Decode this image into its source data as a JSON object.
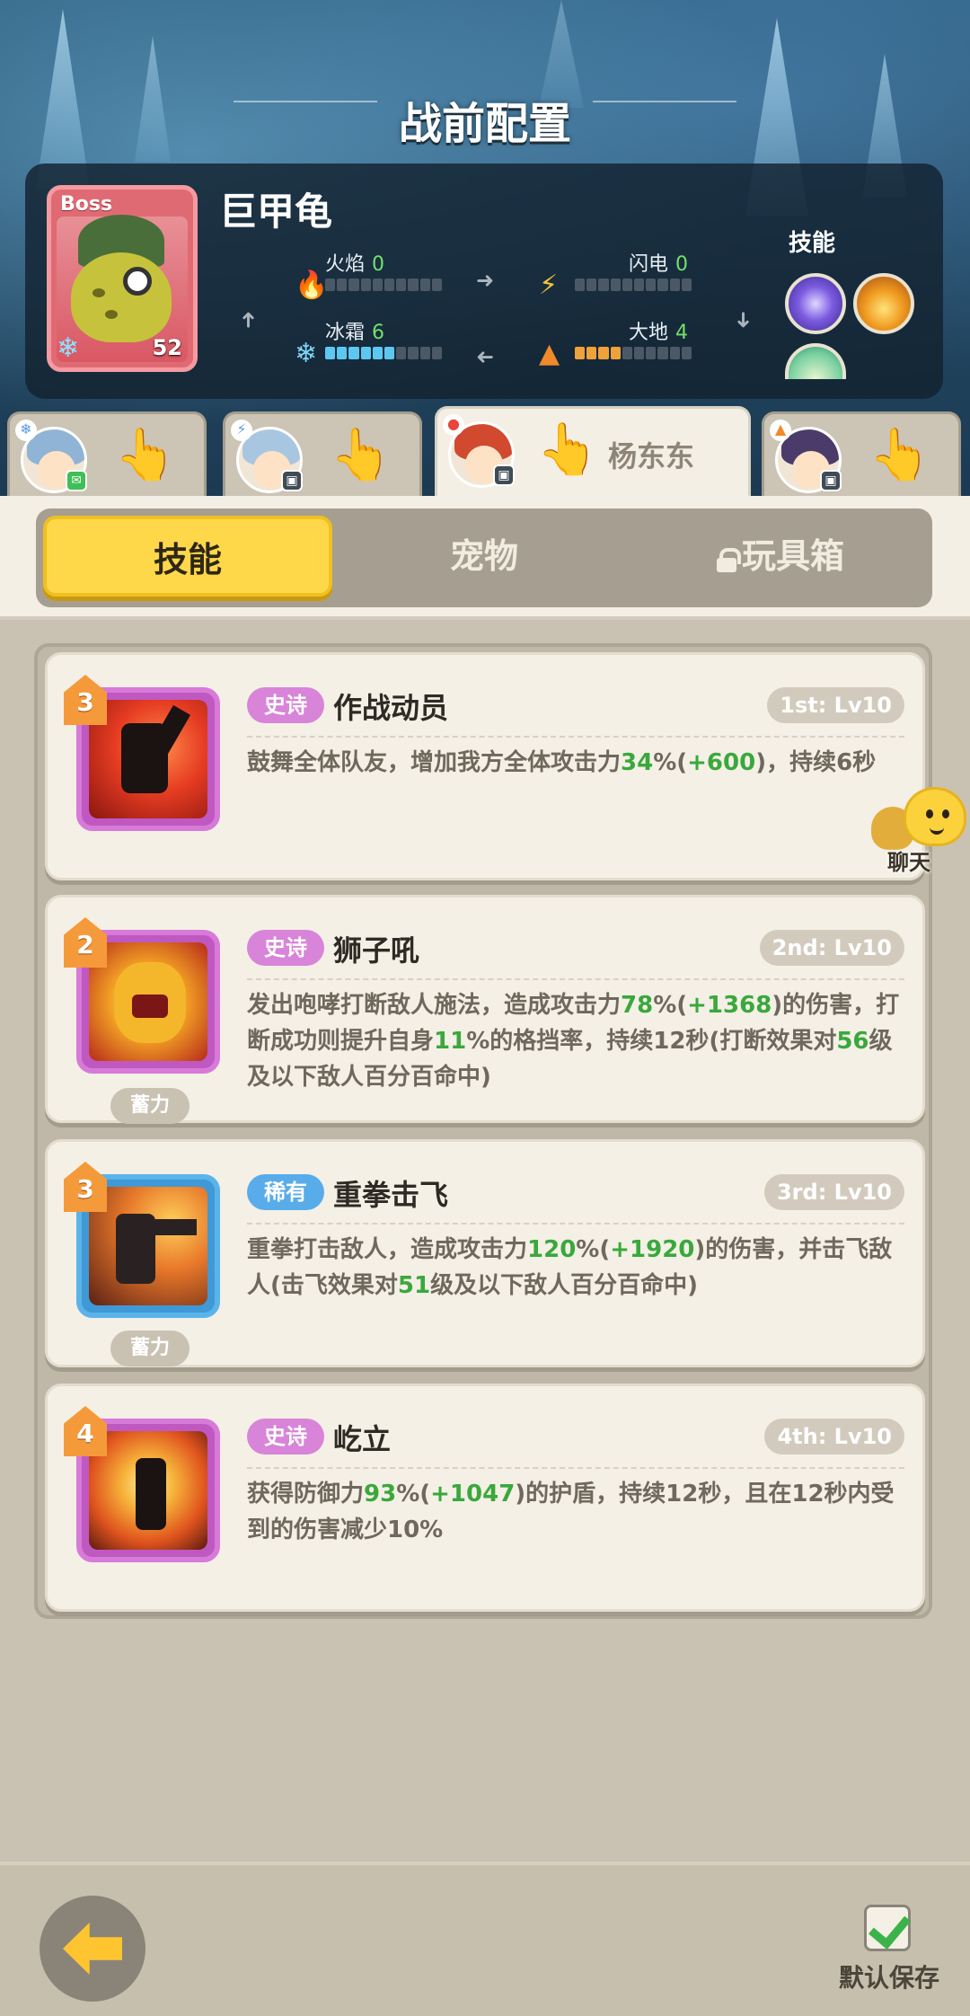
{
  "header": {
    "title": "战前配置"
  },
  "boss": {
    "tag": "Boss",
    "name": "巨甲龟",
    "level": "52",
    "stats": [
      {
        "label": "火焰",
        "value": "0",
        "level": 0,
        "icon": "fire-icon"
      },
      {
        "label": "闪电",
        "value": "0",
        "level": 0,
        "icon": "lightning-icon"
      },
      {
        "label": "冰霜",
        "value": "6",
        "level": 6,
        "icon": "frost-icon"
      },
      {
        "label": "大地",
        "value": "4",
        "level": 4,
        "icon": "earth-icon"
      }
    ],
    "skills_label": "技能"
  },
  "hero_tabs": [
    {
      "name": ""
    },
    {
      "name": ""
    },
    {
      "name": "杨东东",
      "active": true
    },
    {
      "name": ""
    }
  ],
  "segments": {
    "skills": "技能",
    "pets": "宠物",
    "toybox": "玩具箱"
  },
  "skills": [
    {
      "tier": "3",
      "rarity": "史诗",
      "name": "作战动员",
      "slot": "1st: Lv10",
      "charge": "",
      "desc": [
        {
          "t": "鼓舞全体队友，增加我方全体攻击力"
        },
        {
          "t": "34",
          "g": true
        },
        {
          "t": "%("
        },
        {
          "t": "+600",
          "g": true
        },
        {
          "t": ")，持续6秒"
        }
      ]
    },
    {
      "tier": "2",
      "rarity": "史诗",
      "name": "狮子吼",
      "slot": "2nd: Lv10",
      "charge": "蓄力",
      "desc": [
        {
          "t": "发出咆哮打断敌人施法，造成攻击力"
        },
        {
          "t": "78",
          "g": true
        },
        {
          "t": "%("
        },
        {
          "t": "+1368",
          "g": true
        },
        {
          "t": ")的伤害，打断成功则提升自身"
        },
        {
          "t": "11",
          "g": true
        },
        {
          "t": "%的格挡率，持续12秒(打断效果对"
        },
        {
          "t": "56",
          "g": true
        },
        {
          "t": "级及以下敌人百分百命中)"
        }
      ]
    },
    {
      "tier": "3",
      "rarity": "稀有",
      "name": "重拳击飞",
      "slot": "3rd: Lv10",
      "charge": "蓄力",
      "desc": [
        {
          "t": "重拳打击敌人，造成攻击力"
        },
        {
          "t": "120",
          "g": true
        },
        {
          "t": "%("
        },
        {
          "t": "+1920",
          "g": true
        },
        {
          "t": ")的伤害，并击飞敌人(击飞效果对"
        },
        {
          "t": "51",
          "g": true
        },
        {
          "t": "级及以下敌人百分百命中)"
        }
      ]
    },
    {
      "tier": "4",
      "rarity": "史诗",
      "name": "屹立",
      "slot": "4th: Lv10",
      "charge": "",
      "desc": [
        {
          "t": "获得防御力"
        },
        {
          "t": "93",
          "g": true
        },
        {
          "t": "%("
        },
        {
          "t": "+1047",
          "g": true
        },
        {
          "t": ")的护盾，持续12秒，且在12秒内受到的伤害减少10%"
        }
      ]
    }
  ],
  "chat": {
    "label": "聊天"
  },
  "footer": {
    "save_label": "默认保存"
  }
}
